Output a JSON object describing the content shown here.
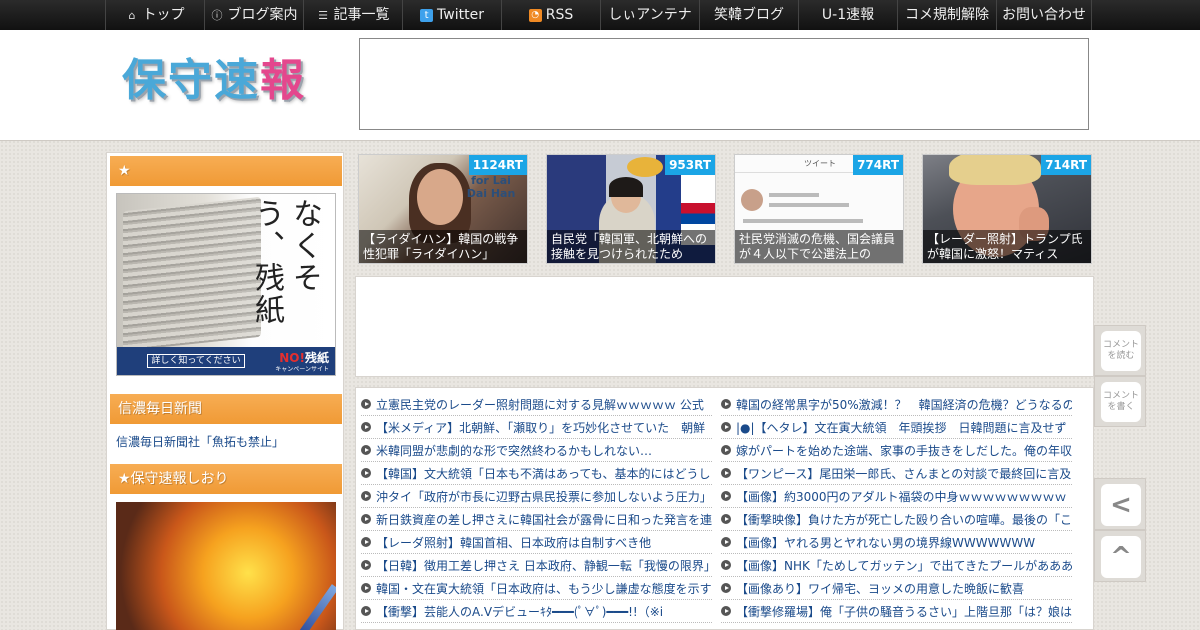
{
  "nav": {
    "items": [
      {
        "label": "トップ",
        "icon": "home-icon"
      },
      {
        "label": "ブログ案内",
        "icon": "info-icon"
      },
      {
        "label": "記事一覧",
        "icon": "list-icon"
      },
      {
        "label": "Twitter",
        "icon": "twitter-icon"
      },
      {
        "label": "RSS",
        "icon": "rss-icon"
      },
      {
        "label": "しぃアンテナ"
      },
      {
        "label": "笑韓ブログ"
      },
      {
        "label": "U-1速報"
      },
      {
        "label": "コメ規制解除"
      },
      {
        "label": "お問い合わせ"
      }
    ]
  },
  "header": {
    "logo_part1": "保守速",
    "logo_part2": "報"
  },
  "sidebar": {
    "head1": "★",
    "banner1": {
      "vertical_text": "なくそう、残紙",
      "button": "詳しく知ってください",
      "no": "NO!",
      "zanshi": "残紙",
      "sub": "キャンペーンサイト"
    },
    "head2": "信濃毎日新聞",
    "link1": "信濃毎日新聞社「魚拓も禁止」",
    "head3": "★保守速報しおり"
  },
  "thumbs": [
    {
      "rt": "1124RT",
      "caption": "【ライダイハン】韓国の戦争性犯罪「ライダイハン」",
      "sign": "Justice for Lai Dai Han"
    },
    {
      "rt": "953RT",
      "caption": "自民党「韓国軍、北朝鮮への接触を見つけられたため"
    },
    {
      "rt": "774RT",
      "caption": "社民党消滅の危機、国会議員が４人以下で公選法上の",
      "tweet_header": "ツイート"
    },
    {
      "rt": "714RT",
      "caption": "【レーダー照射】トランプ氏が韓国に激怒！マティス"
    }
  ],
  "articles": {
    "left": [
      "立憲民主党のレーダー照射問題に対する見解ｗｗｗｗｗ 公式",
      "【米メディア】北朝鮮、「瀬取り」を巧妙化させていた　朝鮮",
      "米韓同盟が悲劇的な形で突然終わるかもしれない…",
      "【韓国】文大統領「日本も不満はあっても、基本的にはどうし",
      "沖タイ「政府が市長に辺野古県民投票に参加しないよう圧力」",
      "新日鉄資産の差し押さえに韓国社会が露骨に日和った発言を連",
      "【レーダ照射】韓国首相、日本政府は自制すべき他",
      "【日韓】徴用工差し押さえ 日本政府、静観一転「我慢の限界」",
      "韓国・文在寅大統領「日本政府は、もう少し謙虚な態度を示す",
      "【衝撃】芸能人のA.Vデビューｷﾀ━━━(ﾟ∀ﾟ)━━━!!（※i"
    ],
    "right": [
      "韓国の経常黒字が50%激減！？　韓国経済の危機？どうなるの",
      "|●|【ヘタレ】文在寅大統領　年頭挨拶　日韓問題に言及せず",
      "嫁がパートを始めた途端、家事の手抜きをしだした。俺の年収",
      "【ワンピース】尾田栄一郎氏、さんまとの対談で最終回に言及",
      "【画像】約3000円のアダルト福袋の中身ｗｗｗｗｗｗｗｗｗ",
      "【衝撃映像】負けた方が死亡した殴り合いの喧嘩。最後の「こ",
      "【画像】ヤれる男とヤれない男の境界線WWWWWWW",
      "【画像】NHK「ためしてガッテン」で出てきたプールがあああ",
      "【画像あり】ワイ帰宅、ヨッメの用意した晩飯に歓喜",
      "【衝撃修羅場】俺「子供の騒音うるさい」上階旦那「は？娘は"
    ]
  },
  "float": {
    "read_comments": "コメントを読む",
    "write_comments": "コメントを書く",
    "back": "<",
    "top": "^"
  }
}
